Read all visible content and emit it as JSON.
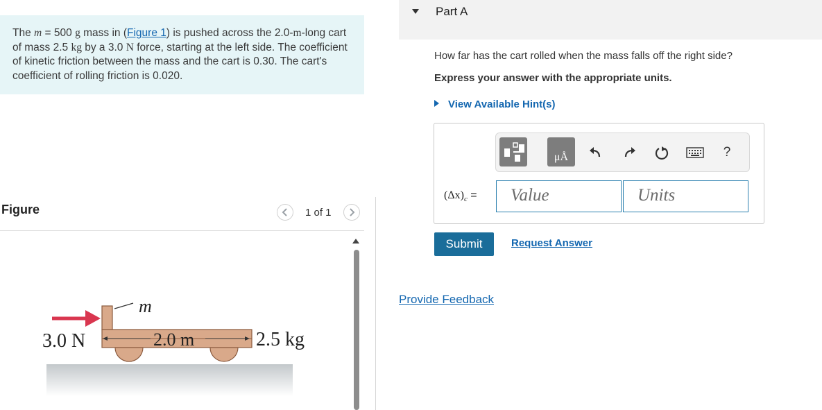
{
  "problem": {
    "t1": "The ",
    "m_sym": "m",
    "t2": " = 500 ",
    "g_unit": "g",
    "t3": " mass in (",
    "figure_link": "Figure 1",
    "t4": ") is pushed across the 2.0-",
    "m_unit": "m",
    "t5": "-long cart of mass 2.5 ",
    "kg_unit": "kg",
    "t6": " by a 3.0 ",
    "n_unit": "N",
    "t7": " force, starting at the left side. The coefficient of kinetic friction between the mass and the cart is 0.30. The cart's coefficient of rolling friction is 0.020."
  },
  "figure_panel": {
    "label": "Figure",
    "page_indicator": "1 of 1",
    "prev_icon": "chevron-left-icon",
    "next_icon": "chevron-right-icon"
  },
  "figure": {
    "force_label": "3.0 N",
    "mass_label": "m",
    "length_label": "2.0 m",
    "cart_mass_label": "2.5 kg"
  },
  "part_a": {
    "title": "Part A",
    "question": "How far has the cart rolled when the mass falls off the right side?",
    "instruction": "Express your answer with the appropriate units.",
    "hint_link": "View Available Hint(s)",
    "answer_label": "(Δx)",
    "answer_sub": "c",
    "answer_eq": " =",
    "value_placeholder": "Value",
    "units_placeholder": "Units",
    "symbols_label": "μÅ",
    "help_label": "?",
    "submit_label": "Submit",
    "request_answer_label": "Request Answer"
  },
  "feedback_link": "Provide Feedback",
  "colors": {
    "problem_bg": "#e6f5f7",
    "link": "#1467b0",
    "submit_bg": "#1a6d9a",
    "cart": "#d9a98a",
    "force_arrow": "#d9364f"
  }
}
